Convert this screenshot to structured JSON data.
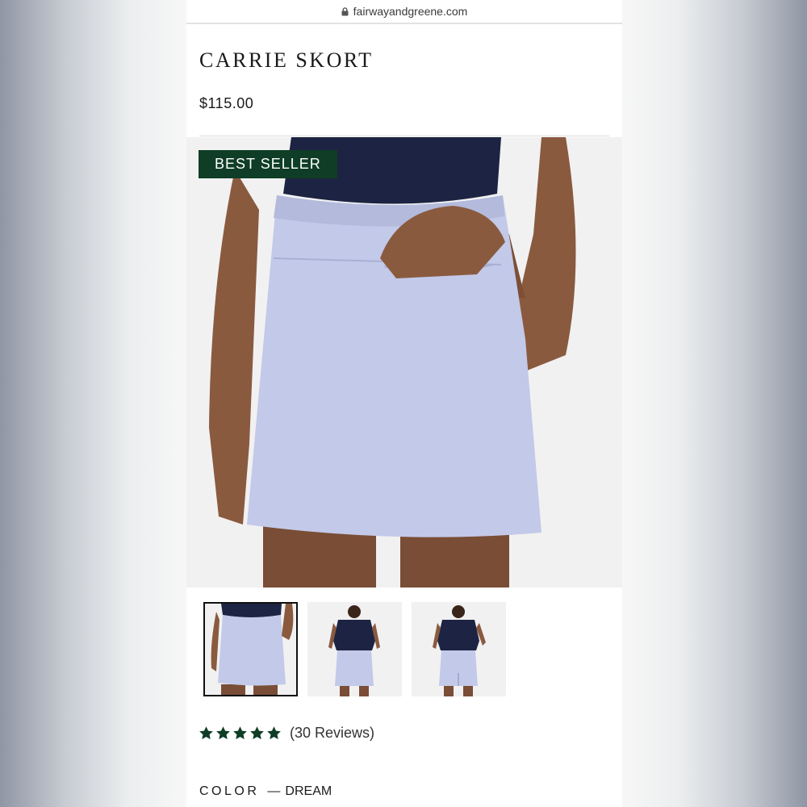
{
  "browser": {
    "url": "fairwayandgreene.com"
  },
  "product": {
    "title": "CARRIE SKORT",
    "price": "$115.00",
    "badge": "BEST SELLER",
    "rating_count_text": "(30 Reviews)",
    "rating_stars": 5,
    "color_label": "COLOR",
    "color_separator": "—",
    "color_value": "DREAM"
  },
  "colors": {
    "badge_bg": "#0f3d26",
    "star": "#0f3d26",
    "skirt": "#c3c9e8",
    "top": "#1d2342"
  },
  "icons": [
    "lock-icon",
    "star-icon"
  ],
  "thumbnails": [
    {
      "view": "front-closeup",
      "selected": true
    },
    {
      "view": "front-full",
      "selected": false
    },
    {
      "view": "back-full",
      "selected": false
    }
  ]
}
